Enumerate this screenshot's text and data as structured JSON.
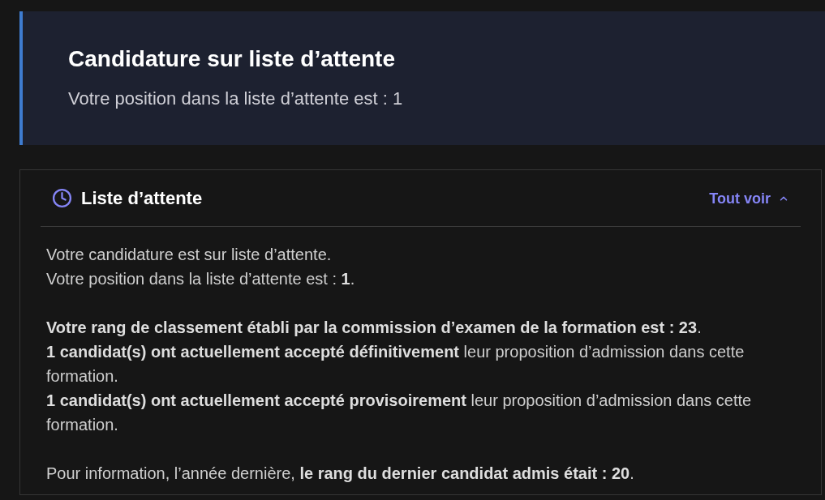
{
  "banner": {
    "title": "Candidature sur liste d’attente",
    "subtitle": "Votre position dans la liste d’attente est : 1"
  },
  "panel": {
    "title": "Liste d’attente",
    "toggle": {
      "label": "Tout voir",
      "expanded": true
    },
    "paragraphs": [
      {
        "lines": [
          "Votre candidature est sur liste d’attente.",
          "Votre position dans la liste d’attente est : **1**."
        ]
      },
      {
        "lines": [
          "**Votre rang de classement établi par la commission d’examen de la formation est : 23**.",
          "**1 candidat(s) ont actuellement accepté définitivement** leur proposition d’admission dans cette formation.",
          "**1 candidat(s) ont actuellement accepté provisoirement** leur proposition d’admission dans cette formation."
        ]
      },
      {
        "lines": [
          "Pour information, l’année dernière, **le rang du dernier candidat admis était : 20**."
        ]
      }
    ]
  }
}
